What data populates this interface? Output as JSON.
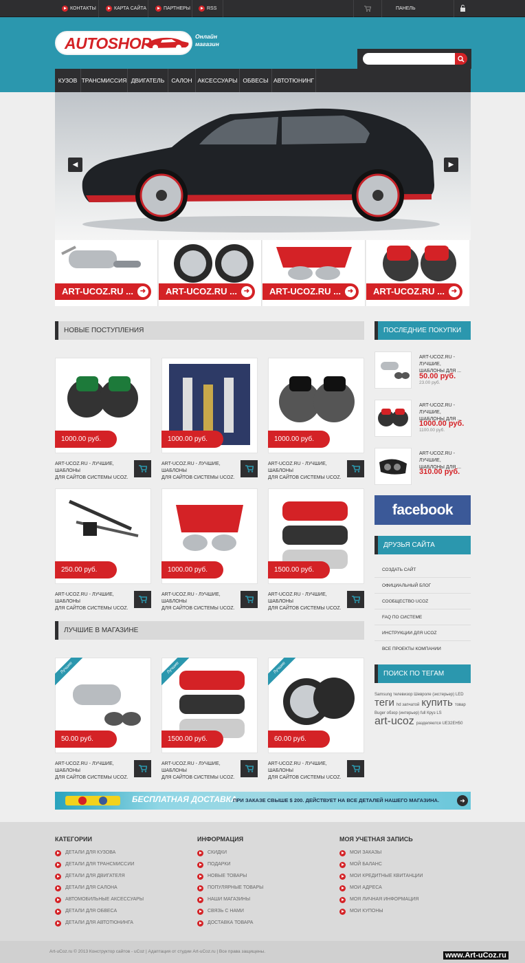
{
  "topbar": {
    "links": [
      "КОНТАКТЫ",
      "КАРТА САЙТА",
      "ПАРТНЕРЫ",
      "RSS"
    ],
    "panel": "ПАНЕЛЬ УПРАВЛЕНИЯ"
  },
  "logo": {
    "text": "AUTOSHOP",
    "sub1": "Онлайн",
    "sub2": "магазин"
  },
  "search": {
    "placeholder": ""
  },
  "nav": [
    "КУЗОВ",
    "ТРАНСМИССИЯ",
    "ДВИГАТЕЛЬ",
    "САЛОН",
    "АКСЕССУАРЫ",
    "ОБВЕСЫ",
    "АВТОТЮНИНГ"
  ],
  "slider_thumbs": [
    "ART-UCOZ.RU ...",
    "ART-UCOZ.RU ...",
    "ART-UCOZ.RU ...",
    "ART-UCOZ.RU ..."
  ],
  "sections": {
    "new": "НОВЫЕ ПОСТУПЛЕНИЯ",
    "best": "ЛУЧШИЕ В МАГАЗИНЕ"
  },
  "product_title": [
    "ART-UCOZ.RU - ЛУЧШИЕ, ШАБЛОНЫ",
    "ДЛЯ САЙТОВ СИСТЕМЫ UCOZ."
  ],
  "new_products": [
    {
      "price": "1000.00 руб."
    },
    {
      "price": "1000.00 руб."
    },
    {
      "price": "1000.00 руб."
    },
    {
      "price": "250.00 руб."
    },
    {
      "price": "1000.00 руб."
    },
    {
      "price": "1500.00 руб."
    }
  ],
  "best_products": [
    {
      "price": "50.00 руб.",
      "badge": "Лучшие"
    },
    {
      "price": "1500.00 руб.",
      "badge": "Лучшие"
    },
    {
      "price": "60.00 руб.",
      "badge": "Лучшие"
    }
  ],
  "sidebar": {
    "recent_head": "ПОСЛЕДНИЕ ПОКУПКИ",
    "recent": [
      {
        "title1": "ART-UCOZ.RU - ЛУЧШИЕ,",
        "title2": "ШАБЛОНЫ ДЛЯ ...",
        "price": "50.00 руб.",
        "old": "23.00 руб."
      },
      {
        "title1": "ART-UCOZ.RU - ЛУЧШИЕ,",
        "title2": "ШАБЛОНЫ ДЛЯ ...",
        "price": "1000.00 руб.",
        "old": "1100.00 руб."
      },
      {
        "title1": "ART-UCOZ.RU - ЛУЧШИЕ,",
        "title2": "ШАБЛОНЫ ДЛЯ ...",
        "price": "310.00 руб.",
        "old": ""
      }
    ],
    "facebook": "facebook",
    "friends_head": "ДРУЗЬЯ САЙТА",
    "friends": [
      "СОЗДАТЬ САЙТ",
      "ОФИЦИАЛЬНЫЙ БЛОГ",
      "СООБЩЕСТВО UCOZ",
      "FAQ ПО СИСТЕМЕ",
      "ИНСТРУКЦИИ ДЛЯ UCOZ",
      "ВСЕ ПРОЕКТЫ КОМПАНИИ"
    ],
    "tags_head": "ПОИСК ПО ТЕГАМ",
    "tags": {
      "line1": "Samsung телевизор Шевроле (экстерьер) LED",
      "big1": "теги",
      "hd": "hd запчатой",
      "big2": "купить",
      "tovar": "товар",
      "line3": "Buger обзор (интерьер) full Круз LS",
      "big3": "art-ucoz",
      "line4": "разделяются UE32EH50"
    }
  },
  "banner": {
    "title": "БЕСПЛАТНАЯ ДОСТАВКА",
    "text": "ПРИ ЗАКАЗЕ СВЫШЕ $ 200. ДЕЙСТВУЕТ НА ВСЕ ДЕТАЛЕЙ НАШЕГО МАГАЗИНА."
  },
  "footer": {
    "categories_head": "КАТЕГОРИИ",
    "categories": [
      "ДЕТАЛИ ДЛЯ КУЗОВА",
      "ДЕТАЛИ ДЛЯ ТРАНСМИССИИ",
      "ДЕТАЛИ ДЛЯ ДВИГАТЕЛЯ",
      "ДЕТАЛИ ДЛЯ САЛОНА",
      "АВТОМОБИЛЬНЫЕ АКСЕССУАРЫ",
      "ДЕТАЛИ ДЛЯ ОБВЕСА",
      "ДЕТАЛИ ДЛЯ АВТОТЮНИНГА"
    ],
    "info_head": "ИНФОРМАЦИЯ",
    "info": [
      "СКИДКИ",
      "ПОДАРКИ",
      "НОВЫЕ ТОВАРЫ",
      "ПОПУЛЯРНЫЕ ТОВАРЫ",
      "НАШИ МАГАЗИНЫ",
      "СВЯЗЬ С НАМИ",
      "ДОСТАВКА ТОВАРА"
    ],
    "account_head": "МОЯ УЧЕТНАЯ ЗАПИСЬ",
    "account": [
      "МОИ ЗАКАЗЫ",
      "МОЙ БАЛАНС",
      "МОИ КРЕДИТНЫЕ КВИТАНЦИИ",
      "МОИ АДРЕСА",
      "МОЯ ЛИЧНАЯ ИНФОРМАЦИЯ",
      "МОИ КУПОНЫ"
    ],
    "copyright": "Art-uCoz.ru © 2013 Конструктор сайтов - uCoz | Адаптация от студии Art-uCoz.ru | Все права защищены.",
    "watermark": "www.Art-uCoz.ru"
  },
  "colors": {
    "accent": "#2b97ae",
    "red": "#d42226",
    "dark": "#2e2e30"
  }
}
